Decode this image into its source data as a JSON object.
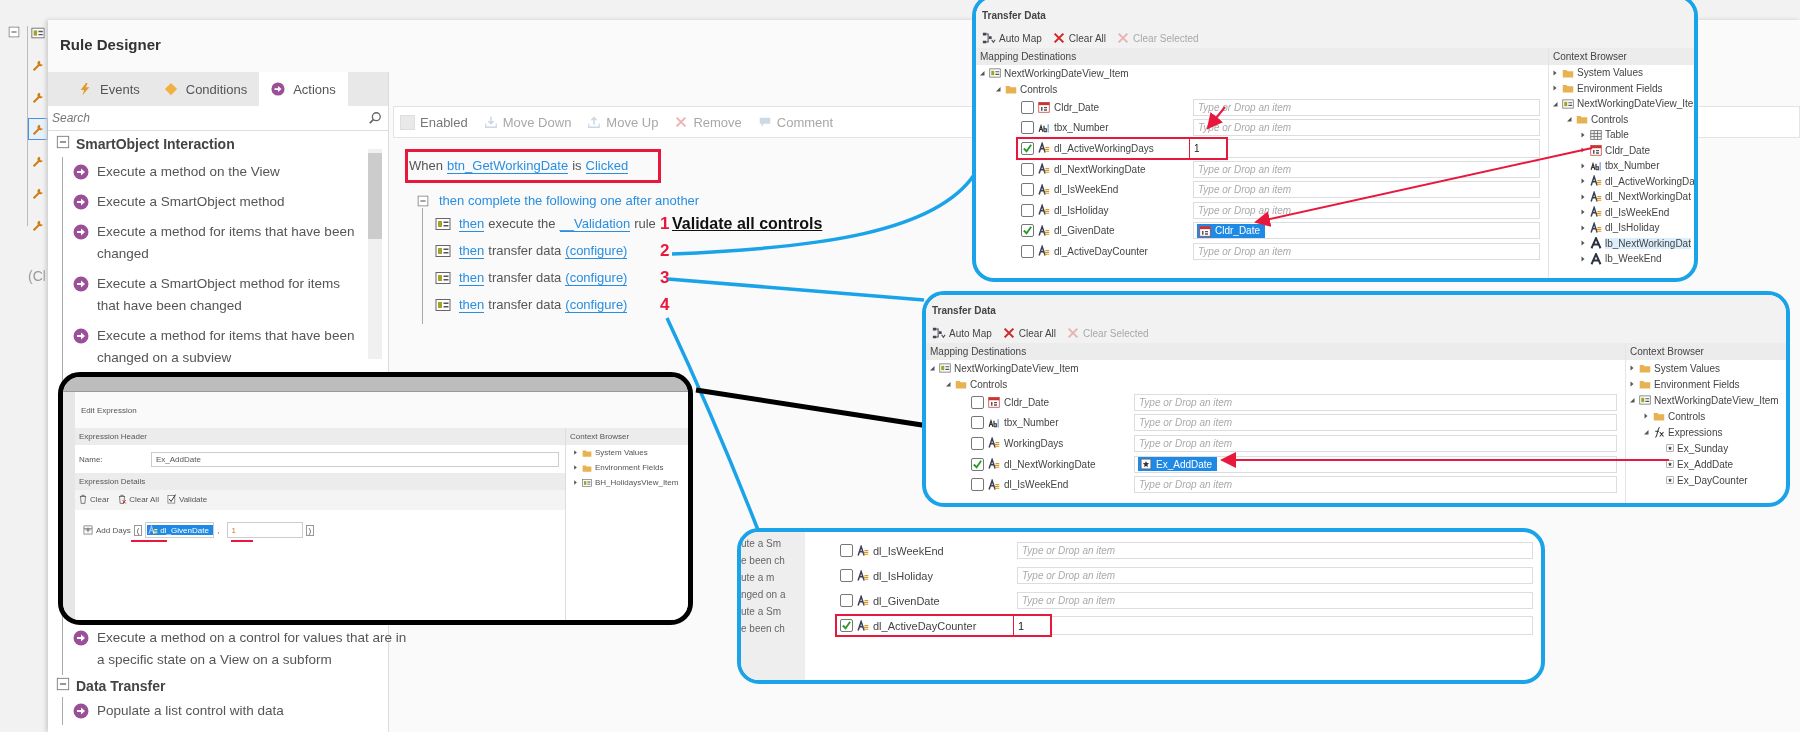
{
  "sidebar": {
    "fragment": "(Cl",
    "tools": [
      {
        "kind": "view",
        "selected": false
      },
      {
        "kind": "wrench",
        "selected": false
      },
      {
        "kind": "wrench",
        "selected": false
      },
      {
        "kind": "wrench",
        "selected": true
      },
      {
        "kind": "wrench",
        "selected": false
      },
      {
        "kind": "wrench",
        "selected": false
      },
      {
        "kind": "wrench",
        "selected": false
      }
    ]
  },
  "designer": {
    "title": "Rule Designer",
    "tabs": [
      {
        "label": "Events",
        "kind": "bolt",
        "selected": false
      },
      {
        "label": "Conditions",
        "kind": "diamond",
        "selected": false
      },
      {
        "label": "Actions",
        "kind": "action",
        "selected": true
      }
    ],
    "search": {
      "placeholder": "Search"
    },
    "categories": [
      {
        "title": "SmartObject Interaction",
        "expanded": true,
        "items": [
          "Execute a method on the View",
          "Execute a SmartObject method",
          "Execute a method for items that have been changed",
          "Execute a SmartObject method for items that have been changed",
          "Execute a method for items that have been changed on a subview",
          "Execute a method on a control for values that are in a specific state on a View on a subform"
        ]
      },
      {
        "title": "Data Transfer",
        "expanded": true,
        "items": [
          "Populate a list control with data"
        ]
      }
    ],
    "toolbar": [
      {
        "label": "Enabled",
        "kind": "checkbox",
        "disabled": false
      },
      {
        "label": "Move Down",
        "kind": "down",
        "disabled": true
      },
      {
        "label": "Move Up",
        "kind": "up",
        "disabled": true
      },
      {
        "label": "Remove",
        "kind": "remove",
        "disabled": true
      },
      {
        "label": "Comment",
        "kind": "comment",
        "disabled": true
      }
    ],
    "rule": {
      "when": {
        "prefix": "When",
        "control": "btn_GetWorkingDate",
        "is": "is",
        "event": "Clicked"
      },
      "group": "then complete the following one after another",
      "steps": [
        {
          "lead": "then",
          "text": "execute the",
          "link": "__Validation",
          "tail": "rule",
          "number": "1",
          "note": "Validate all controls"
        },
        {
          "lead": "then",
          "text": "transfer data",
          "link": "(configure)",
          "number": "2"
        },
        {
          "lead": "then",
          "text": "transfer data",
          "link": "(configure)",
          "number": "3"
        },
        {
          "lead": "then",
          "text": "transfer data",
          "link": "(configure)",
          "number": "4"
        }
      ]
    }
  },
  "panels": [
    {
      "title": "Transfer Data",
      "toolbar": [
        {
          "label": "Auto Map",
          "kind": "automap",
          "disabled": false
        },
        {
          "label": "Clear All",
          "kind": "clear",
          "disabled": false
        },
        {
          "label": "Clear Selected",
          "kind": "clear",
          "disabled": true
        }
      ],
      "dest_header": "Mapping Destinations",
      "browser_header": "Context Browser",
      "root": "NextWorkingDateView_Item",
      "controls": "Controls",
      "rows": [
        {
          "name": "Cldr_Date",
          "kind": "calendar",
          "checked": false,
          "highlighted": false,
          "field": {
            "kind": "placeholder",
            "placeholder": "Type or Drop an item"
          }
        },
        {
          "name": "tbx_Number",
          "kind": "textbox",
          "checked": false,
          "highlighted": false,
          "field": {
            "kind": "placeholder",
            "placeholder": "Type or Drop an item"
          }
        },
        {
          "name": "dl_ActiveWorkingDays",
          "kind": "datalabel",
          "checked": true,
          "highlighted": true,
          "field": {
            "kind": "value",
            "value": "1"
          }
        },
        {
          "name": "dl_NextWorkingDate",
          "kind": "datalabel",
          "checked": false,
          "highlighted": false,
          "field": {
            "kind": "placeholder",
            "placeholder": "Type or Drop an item"
          }
        },
        {
          "name": "dl_IsWeekEnd",
          "kind": "datalabel",
          "checked": false,
          "highlighted": false,
          "field": {
            "kind": "placeholder",
            "placeholder": "Type or Drop an item"
          }
        },
        {
          "name": "dl_IsHoliday",
          "kind": "datalabel",
          "checked": false,
          "highlighted": false,
          "field": {
            "kind": "placeholder",
            "placeholder": "Type or Drop an item"
          }
        },
        {
          "name": "dl_GivenDate",
          "kind": "datalabel",
          "checked": true,
          "highlighted": false,
          "field": {
            "kind": "token",
            "token": {
              "text": "Cldr_Date",
              "kind": "calendar"
            }
          }
        },
        {
          "name": "dl_ActiveDayCounter",
          "kind": "datalabel",
          "checked": false,
          "highlighted": false,
          "field": {
            "kind": "placeholder",
            "placeholder": "Type or Drop an item"
          }
        }
      ],
      "browser": [
        {
          "label": "System Values",
          "kind": "folder",
          "expanded": false,
          "selected": false
        },
        {
          "label": "Environment Fields",
          "kind": "folder",
          "expanded": false,
          "selected": false
        },
        {
          "label": "NextWorkingDateView_Ite",
          "kind": "view",
          "expanded": true,
          "selected": false,
          "children": [
            {
              "label": "Controls",
              "kind": "folder",
              "expanded": true,
              "selected": false,
              "children": [
                {
                  "label": "Table",
                  "kind": "table",
                  "expanded": false,
                  "selected": false
                },
                {
                  "label": "Cldr_Date",
                  "kind": "calendar",
                  "expanded": false,
                  "selected": false
                },
                {
                  "label": "tbx_Number",
                  "kind": "textbox",
                  "expanded": false,
                  "selected": false
                },
                {
                  "label": "dl_ActiveWorkingDa",
                  "kind": "datalabel",
                  "expanded": false,
                  "selected": false
                },
                {
                  "label": "dl_NextWorkingDat",
                  "kind": "datalabel",
                  "expanded": false,
                  "selected": false
                },
                {
                  "label": "dl_IsWeekEnd",
                  "kind": "datalabel",
                  "expanded": false,
                  "selected": false
                },
                {
                  "label": "dl_IsHoliday",
                  "kind": "datalabel",
                  "expanded": false,
                  "selected": false
                },
                {
                  "label": "lb_NextWorkingDat",
                  "kind": "label",
                  "expanded": false,
                  "selected": true
                },
                {
                  "label": "lb_WeekEnd",
                  "kind": "label",
                  "expanded": false,
                  "selected": false
                }
              ]
            }
          ]
        }
      ]
    },
    {
      "title": "Transfer Data",
      "toolbar": [
        {
          "label": "Auto Map",
          "kind": "automap",
          "disabled": false
        },
        {
          "label": "Clear All",
          "kind": "clear",
          "disabled": false
        },
        {
          "label": "Clear Selected",
          "kind": "clear",
          "disabled": true
        }
      ],
      "dest_header": "Mapping Destinations",
      "browser_header": "Context Browser",
      "root": "NextWorkingDateView_Item",
      "controls": "Controls",
      "rows": [
        {
          "name": "Cldr_Date",
          "kind": "calendar",
          "checked": false,
          "highlighted": false,
          "field": {
            "kind": "placeholder",
            "placeholder": "Type or Drop an item"
          }
        },
        {
          "name": "tbx_Number",
          "kind": "textbox",
          "checked": false,
          "highlighted": false,
          "field": {
            "kind": "placeholder",
            "placeholder": "Type or Drop an item"
          }
        },
        {
          "name": "WorkingDays",
          "kind": "datalabel",
          "checked": false,
          "highlighted": false,
          "field": {
            "kind": "placeholder",
            "placeholder": "Type or Drop an item"
          }
        },
        {
          "name": "dl_NextWorkingDate",
          "kind": "datalabel",
          "checked": true,
          "highlighted": false,
          "field": {
            "kind": "token",
            "token": {
              "text": "Ex_AddDate",
              "kind": "expression"
            }
          }
        },
        {
          "name": "dl_IsWeekEnd",
          "kind": "datalabel",
          "checked": false,
          "highlighted": false,
          "field": {
            "kind": "placeholder",
            "placeholder": "Type or Drop an item"
          }
        }
      ],
      "browser": [
        {
          "label": "System Values",
          "kind": "folder",
          "expanded": false
        },
        {
          "label": "Environment Fields",
          "kind": "folder",
          "expanded": false
        },
        {
          "label": "NextWorkingDateView_Item",
          "kind": "view",
          "expanded": true,
          "children": [
            {
              "label": "Controls",
              "kind": "folder",
              "expanded": false
            },
            {
              "label": "Expressions",
              "kind": "fx",
              "expanded": true,
              "children": [
                {
                  "label": "Ex_Sunday",
                  "kind": "expression"
                },
                {
                  "label": "Ex_AddDate",
                  "kind": "expression"
                },
                {
                  "label": "Ex_DayCounter",
                  "kind": "expression"
                }
              ]
            }
          ]
        }
      ]
    },
    {
      "fragments": [
        "ute a Sm",
        "e been ch",
        "ute a m",
        "nged on a",
        "ute a Sm",
        "e been ch"
      ],
      "rows": [
        {
          "name": "dl_IsWeekEnd",
          "kind": "datalabel",
          "checked": false,
          "highlighted": false,
          "field": {
            "kind": "placeholder",
            "placeholder": "Type or Drop an item"
          }
        },
        {
          "name": "dl_IsHoliday",
          "kind": "datalabel",
          "checked": false,
          "highlighted": false,
          "field": {
            "kind": "placeholder",
            "placeholder": "Type or Drop an item"
          }
        },
        {
          "name": "dl_GivenDate",
          "kind": "datalabel",
          "checked": false,
          "highlighted": false,
          "field": {
            "kind": "placeholder",
            "placeholder": "Type or Drop an item"
          }
        },
        {
          "name": "dl_ActiveDayCounter",
          "kind": "datalabel",
          "checked": true,
          "highlighted": true,
          "field": {
            "kind": "value",
            "value": "1"
          }
        }
      ]
    }
  ],
  "expression": {
    "title": "Edit Expression",
    "header_section": "Expression Header",
    "name_label": "Name:",
    "name_value": "Ex_AddDate",
    "details_section": "Expression Details",
    "tools": [
      {
        "label": "Clear",
        "kind": "trash"
      },
      {
        "label": "Clear All",
        "kind": "trashx"
      },
      {
        "label": "Validate",
        "kind": "validate"
      }
    ],
    "function": "Add Days",
    "open": "(",
    "token": "dl_GivenDate",
    "separator": ",",
    "argument": "1",
    "close": ")",
    "browser_header": "Context Browser",
    "browser": [
      {
        "label": "System Values",
        "kind": "folder",
        "expanded": false
      },
      {
        "label": "Environment Fields",
        "kind": "folder",
        "expanded": false
      },
      {
        "label": "BH_HolidaysView_Item",
        "kind": "view",
        "expanded": false
      }
    ]
  }
}
